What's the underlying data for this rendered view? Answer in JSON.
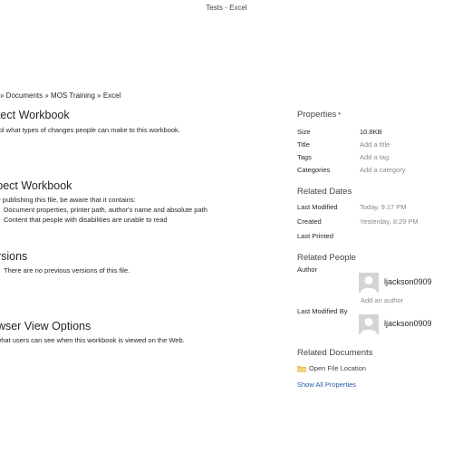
{
  "window": {
    "title": "Tests - Excel"
  },
  "breadcrumb": "» Documents » MOS Training » Excel",
  "sections": {
    "protect": {
      "heading": "otect Workbook",
      "description": "ntrol what types of changes people can make to this workbook."
    },
    "inspect": {
      "heading": "spect Workbook",
      "description": "ore publishing this file, be aware that it contains:",
      "items": [
        "Document properties, printer path, author's name and absolute path",
        "Content that people with disabilities are unable to read"
      ]
    },
    "versions": {
      "heading": "ersions",
      "text": "There are no previous versions of this file."
    },
    "browser": {
      "heading": "owser View Options",
      "description": "k what users can see when this workbook is viewed on the Web."
    }
  },
  "properties": {
    "heading": "Properties",
    "caret": "▾",
    "size": {
      "label": "Size",
      "value": "10.8KB"
    },
    "title": {
      "label": "Title",
      "value": "Add a title"
    },
    "tags": {
      "label": "Tags",
      "value": "Add a tag"
    },
    "categories": {
      "label": "Categories",
      "value": "Add a category"
    }
  },
  "related_dates": {
    "heading": "Related Dates",
    "last_modified": {
      "label": "Last Modified",
      "value": "Today, 9:17 PM"
    },
    "created": {
      "label": "Created",
      "value": "Yesterday, 8:29 PM"
    },
    "last_printed": {
      "label": "Last Printed",
      "value": ""
    }
  },
  "related_people": {
    "heading": "Related People",
    "author": {
      "label": "Author",
      "name": "ljackson0909",
      "icon": "person-avatar-icon"
    },
    "add_author": "Add an author",
    "last_modified_by": {
      "label": "Last Modified By",
      "name": "ljackson0909",
      "icon": "person-avatar-icon"
    }
  },
  "related_documents": {
    "heading": "Related Documents",
    "open_location": "Open File Location",
    "open_location_icon": "folder-icon",
    "show_all": "Show All Properties"
  },
  "colors": {
    "placeholder_text": "#8a8a8a",
    "link_blue": "#2a5ba8",
    "avatar_bg": "#d4d4d4",
    "folder_yellow": "#e8c15a"
  }
}
